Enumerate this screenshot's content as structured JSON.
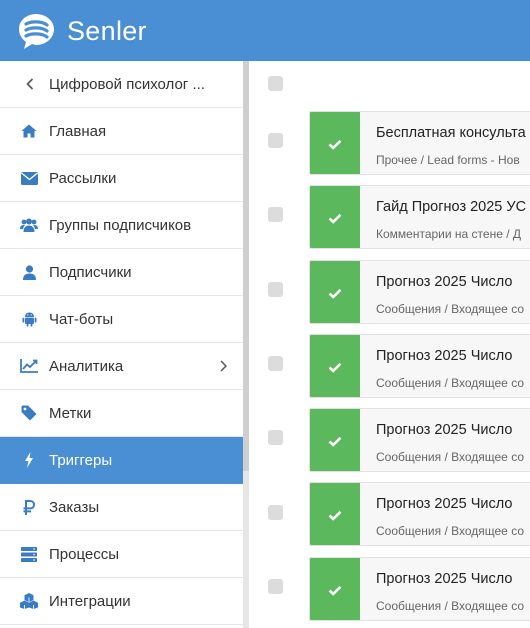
{
  "app": {
    "name": "Senler",
    "brand_color": "#4a8fd3",
    "success_color": "#5cb85c"
  },
  "sidebar": {
    "back": {
      "label": "Цифровой психолог ...",
      "icon": "chevron-left-icon"
    },
    "items": [
      {
        "label": "Главная",
        "icon": "home-icon",
        "active": false
      },
      {
        "label": "Рассылки",
        "icon": "envelope-icon",
        "active": false
      },
      {
        "label": "Группы подписчиков",
        "icon": "users-icon",
        "active": false
      },
      {
        "label": "Подписчики",
        "icon": "user-icon",
        "active": false
      },
      {
        "label": "Чат-боты",
        "icon": "android-icon",
        "active": false
      },
      {
        "label": "Аналитика",
        "icon": "line-chart-icon",
        "active": false,
        "has_submenu": true
      },
      {
        "label": "Метки",
        "icon": "tag-icon",
        "active": false
      },
      {
        "label": "Триггеры",
        "icon": "bolt-icon",
        "active": true
      },
      {
        "label": "Заказы",
        "icon": "ruble-icon",
        "active": false
      },
      {
        "label": "Процессы",
        "icon": "server-icon",
        "active": false
      },
      {
        "label": "Интеграции",
        "icon": "cubes-icon",
        "active": false
      }
    ]
  },
  "triggers": [
    {
      "title": "Бесплатная консульта",
      "subtitle": "Прочее / Lead forms - Нов",
      "status": "enabled"
    },
    {
      "title": "Гайд Прогноз 2025 УС",
      "subtitle": "Комментарии на стене / Д",
      "status": "enabled"
    },
    {
      "title": "Прогноз 2025 Число",
      "subtitle": "Сообщения / Входящее со",
      "status": "enabled"
    },
    {
      "title": "Прогноз 2025 Число",
      "subtitle": "Сообщения / Входящее со",
      "status": "enabled"
    },
    {
      "title": "Прогноз 2025 Число",
      "subtitle": "Сообщения / Входящее со",
      "status": "enabled"
    },
    {
      "title": "Прогноз 2025 Число",
      "subtitle": "Сообщения / Входящее со",
      "status": "enabled"
    },
    {
      "title": "Прогноз 2025 Число",
      "subtitle": "Сообщения / Входящее со",
      "status": "enabled"
    }
  ]
}
